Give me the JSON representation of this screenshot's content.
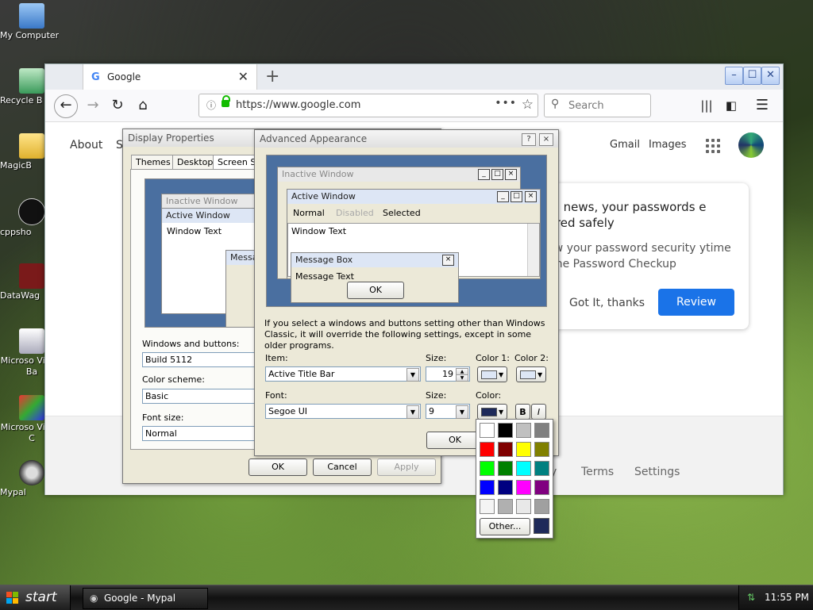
{
  "desktop": {
    "icons": [
      {
        "label": "My Computer"
      },
      {
        "label": "Recycle B"
      },
      {
        "label": "MagicB"
      },
      {
        "label": "cppsho"
      },
      {
        "label": "DataWag"
      },
      {
        "label": "Microso Visual Ba"
      },
      {
        "label": "Microso Visual C"
      },
      {
        "label": "Mypal"
      }
    ]
  },
  "browser": {
    "tab_title": "Google",
    "tab_favicon": "G",
    "new_tab": "+",
    "url": "https://www.google.com",
    "search_placeholder": "Search",
    "page": {
      "about": "About",
      "store_fragment": "S",
      "gmail": "Gmail",
      "images": "Images",
      "card_heading": "ood news, your passwords e stored safely",
      "card_body": "view your password security ytime in the Password Checkup",
      "got_it": "Got It, thanks",
      "review": "Review",
      "footer_frag": "y",
      "terms": "Terms",
      "settings": "Settings"
    }
  },
  "display_properties": {
    "title": "Display Properties",
    "tabs": [
      "Themes",
      "Desktop",
      "Screen Sa"
    ],
    "preview": {
      "inactive": "Inactive Window",
      "active": "Active Window",
      "window_text": "Window Text",
      "message": "Messa"
    },
    "windows_buttons_label": "Windows and buttons:",
    "windows_buttons_value": "Build 5112",
    "color_scheme_label": "Color scheme:",
    "color_scheme_value": "Basic",
    "font_size_label": "Font size:",
    "font_size_value": "Normal",
    "ok": "OK",
    "cancel": "Cancel",
    "apply": "Apply"
  },
  "advanced_appearance": {
    "title": "Advanced Appearance",
    "help_btn": "?",
    "close_btn": "×",
    "preview": {
      "inactive": "Inactive Window",
      "active": "Active Window",
      "menu_normal": "Normal",
      "menu_disabled": "Disabled",
      "menu_selected": "Selected",
      "window_text": "Window Text",
      "message_box": "Message Box",
      "message_text": "Message Text",
      "ok": "OK"
    },
    "info": "If you select a windows and buttons setting other than Windows Classic, it will override the following settings, except in some older programs.",
    "item_label": "Item:",
    "item_value": "Active Title Bar",
    "size_label": "Size:",
    "size_value": "19",
    "color1_label": "Color 1:",
    "color2_label": "Color 2:",
    "font_label": "Font:",
    "font_value": "Segoe UI",
    "font_size_label": "Size:",
    "font_size_value": "9",
    "color_label": "Color:",
    "bold": "B",
    "italic": "I",
    "ok": "OK"
  },
  "color_picker": {
    "other": "Other...",
    "selected_color": "#1e2a5a",
    "swatches": [
      "#ffffff",
      "#000000",
      "#c0c0c0",
      "#808080",
      "#ff0000",
      "#800000",
      "#ffff00",
      "#808000",
      "#00ff00",
      "#008000",
      "#00ffff",
      "#008080",
      "#0000ff",
      "#000080",
      "#ff00ff",
      "#800080",
      "#f4f4f4",
      "#b0b0b0",
      "#e8e8e8",
      "#a0a0a0"
    ]
  },
  "taskbar": {
    "start": "start",
    "task": "Google - Mypal",
    "clock": "11:55 PM"
  }
}
